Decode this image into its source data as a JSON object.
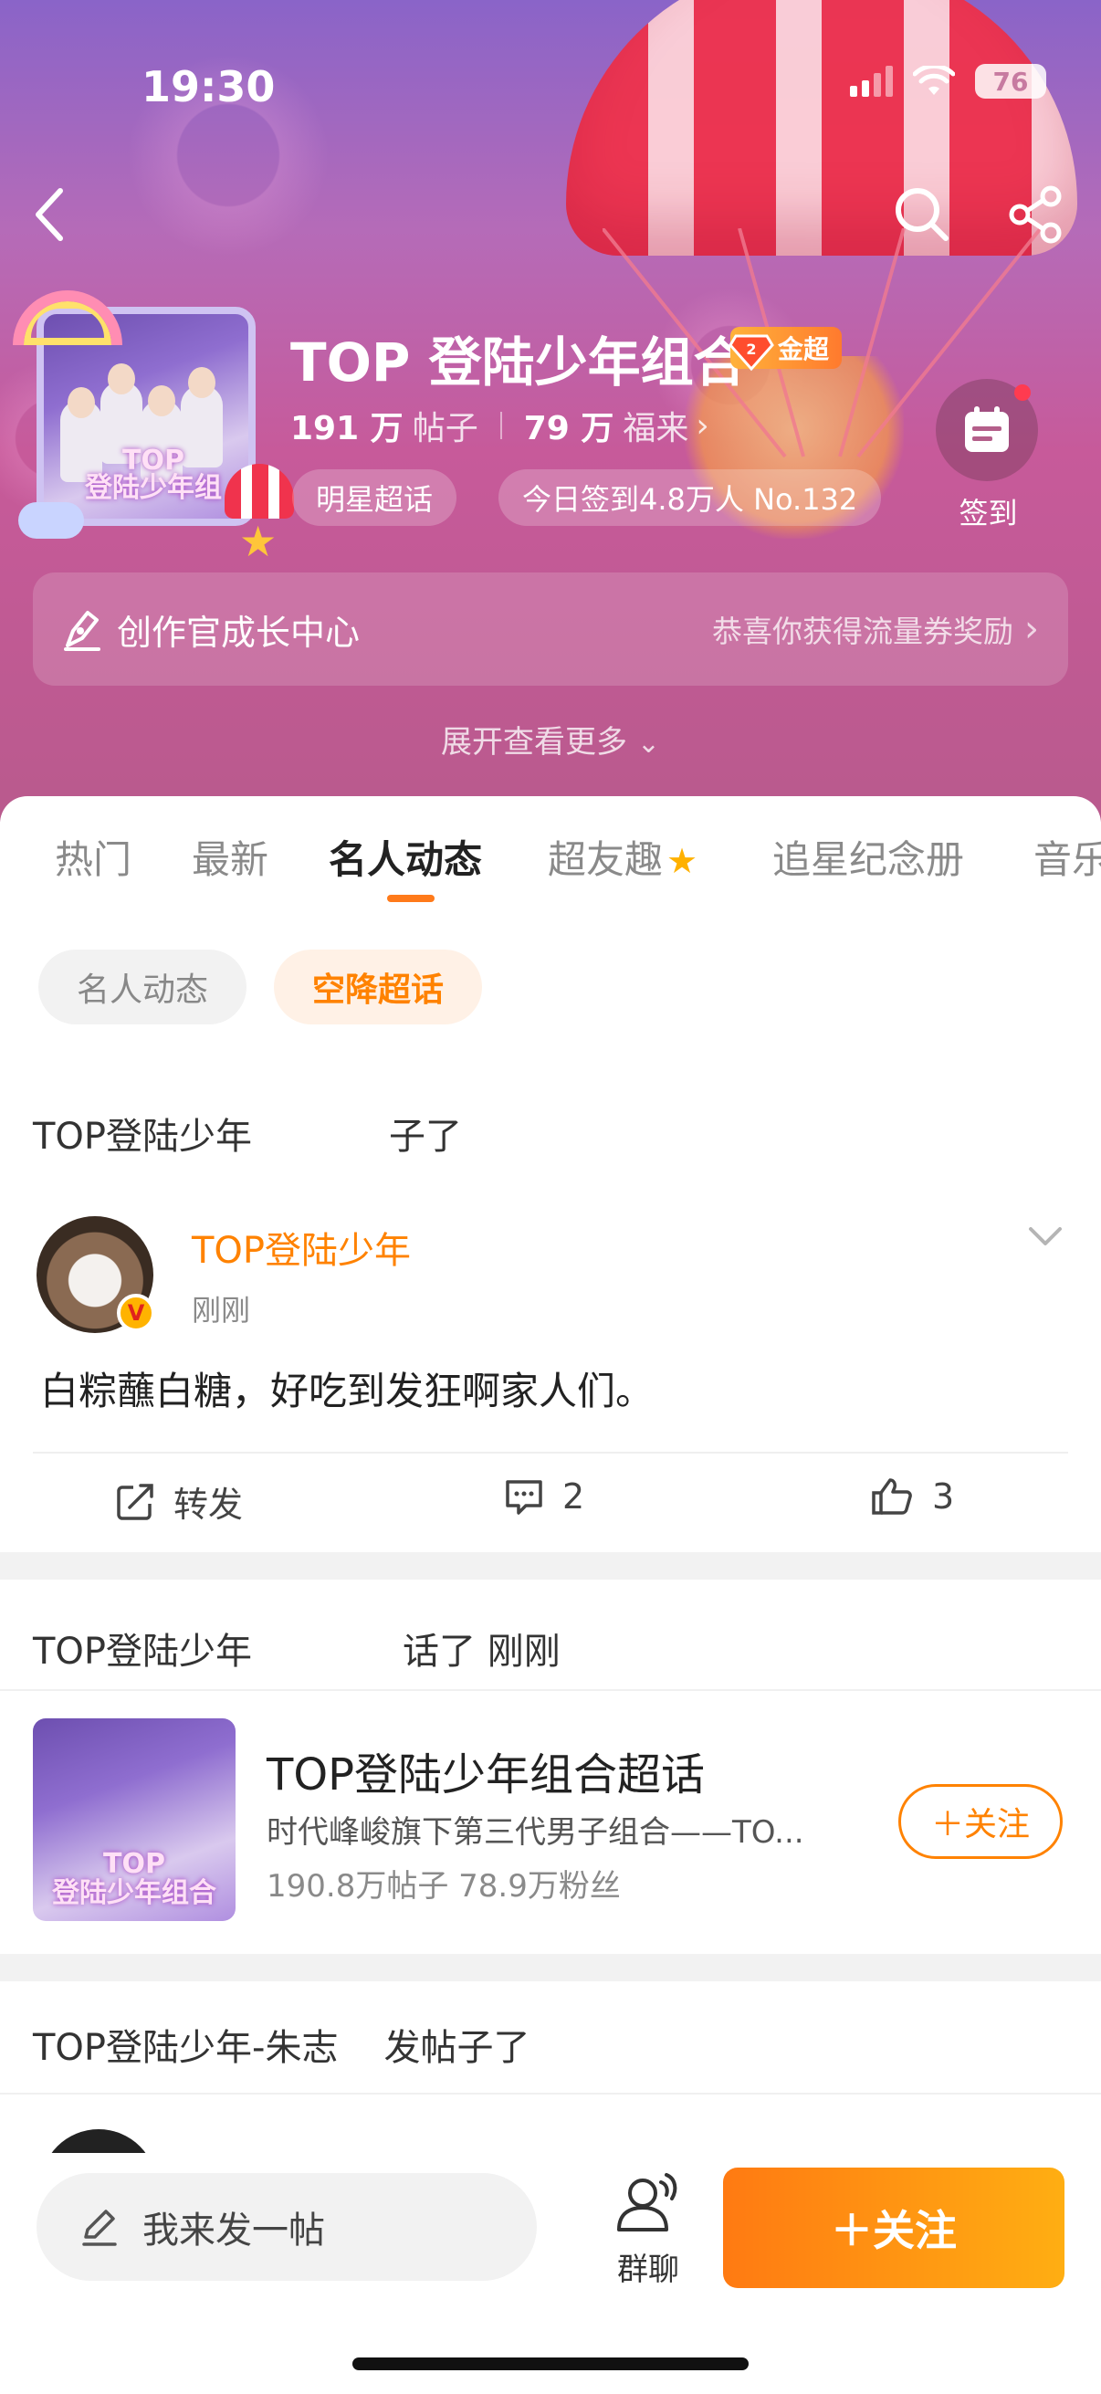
{
  "status_bar": {
    "time": "19:30",
    "battery": "76"
  },
  "header": {
    "group_name": "TOP 登陆少年组合",
    "badge_label": "金超",
    "posts_count": "191 万",
    "posts_label": "帖子",
    "fortune_count": "79 万",
    "fortune_label": "福来",
    "star_pill": "明星超话",
    "signin_pill": "今日签到4.8万人 No.132",
    "checkin_label": "签到",
    "creator_title": "创作官成长中心",
    "creator_reward": "恭喜你获得流量券奖励",
    "expand": "展开查看更多",
    "avatar_caption_1": "TOP",
    "avatar_caption_2": "登陆少年组"
  },
  "tabs": [
    "热门",
    "最新",
    "名人动态",
    "超友趣",
    "追星纪念册",
    "音乐"
  ],
  "chips": [
    "名人动态",
    "空降超话"
  ],
  "feed": {
    "section1_title": "TOP登陆少年",
    "section1_suffix": "子了",
    "post_author": "TOP登陆少年",
    "post_time": "刚刚",
    "post_text": "白粽蘸白糖，好吃到发狂啊家人们。",
    "share_label": "转发",
    "comment_count": "2",
    "like_count": "3",
    "section2_title": "TOP登陆少年",
    "section2_suffix": "话了 刚刚",
    "card_title": "TOP登陆少年组合超话",
    "card_desc": "时代峰峻旗下第三代男子组合——TO...",
    "card_stats": "190.8万帖子  78.9万粉丝",
    "card_follow": "＋关注",
    "card_caption_1": "TOP",
    "card_caption_2": "登陆少年组合",
    "section3_title": "TOP登陆少年-朱志",
    "section3_suffix": "发帖子了"
  },
  "bottom_bar": {
    "compose_placeholder": "我来发一帖",
    "group_chat": "群聊",
    "follow": "＋关注"
  }
}
